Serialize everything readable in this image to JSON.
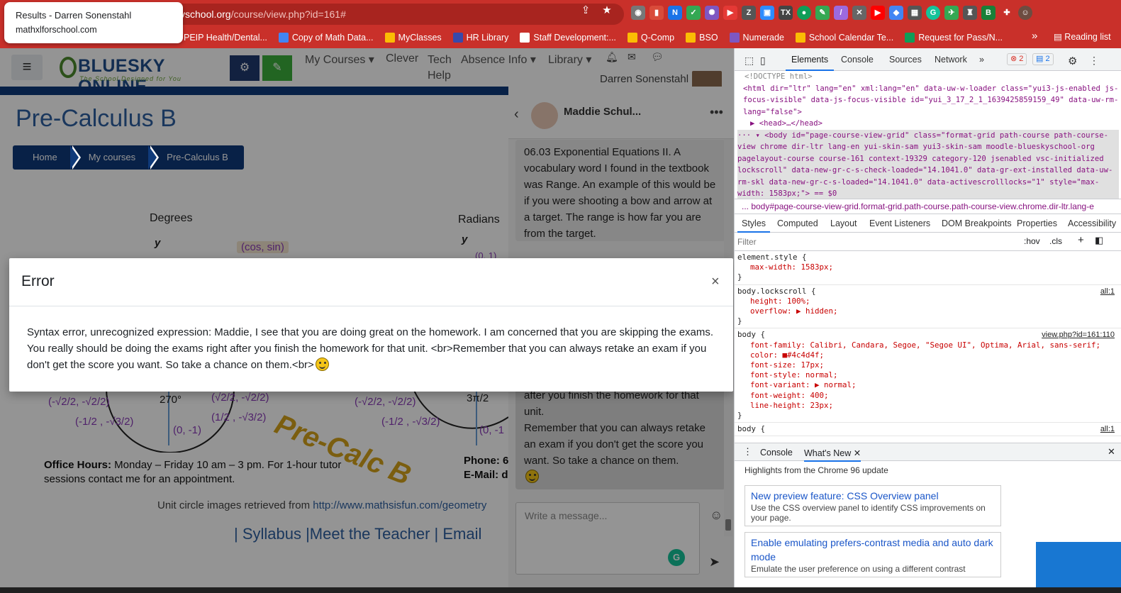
{
  "browser": {
    "tooltip_title": "Results - Darren Sonenstahl",
    "tooltip_url": "mathxlforschool.com",
    "url_main": "yschool.org",
    "url_path": "/course/view.php?id=161#",
    "bookmarks": [
      {
        "label": "PEIP Health/Dental...",
        "color": "#e8710a"
      },
      {
        "label": "Copy of Math Data...",
        "color": "#4285f4"
      },
      {
        "label": "MyClasses",
        "color": "#fbbc04"
      },
      {
        "label": "HR Library",
        "color": "#3949ab"
      },
      {
        "label": "Staff Development:...",
        "color": "#ffffff"
      },
      {
        "label": "Q-Comp",
        "color": "#fbbc04"
      },
      {
        "label": "BSO",
        "color": "#fbbc04"
      },
      {
        "label": "Numerade",
        "color": "#7e57c2"
      },
      {
        "label": "School Calendar Te...",
        "color": "#fbbc04"
      },
      {
        "label": "Request for Pass/N...",
        "color": "#0f9d58"
      }
    ],
    "bookmarks_more": "»",
    "reading_list": "Reading list"
  },
  "site": {
    "logo_text": "BLUESKY ONLINE",
    "logo_tagline": "The School Designed for You",
    "nav": {
      "my_courses": "My Courses ▾",
      "clever": "Clever",
      "tech_help_1": "Tech",
      "tech_help_2": "Help",
      "absence": "Absence Info ▾",
      "library": "Library ▾"
    },
    "user_name": "Darren Sonenstahl",
    "page_title": "Pre-Calculus B",
    "breadcrumb": [
      "Home",
      "My courses",
      "Pre-Calculus B"
    ]
  },
  "content": {
    "degrees": "Degrees",
    "radians": "Radians",
    "y_axis": "y",
    "cos_sin": "(cos, sin)",
    "point_0_1_radians": "(0, 1)",
    "label_270": "270°",
    "label_3pi2": "3π/2",
    "pt_sqrt2_left": "(-√2/2, -√2/2)",
    "pt_sqrt2_right": "(√2/2, -√2/2)",
    "pt_half_left": "(-1/2 , -√3/2)",
    "pt_half_right": "(1/2 , -√3/2)",
    "pt_0_neg1": "(0, -1)",
    "pt_sqrt2_left_r": "(-√2/2, -√2/2)",
    "pt_half_left_r": "(-1/2 , -√3/2)",
    "pt_0_neg1_r": "(0, -1",
    "precalc_stamp": "Pre-Calc B",
    "office_hours_label": "Office Hours:",
    "office_hours_text": " Monday – Friday 10 am – 3 pm.  For 1-hour tutor sessions contact me for an appointment.",
    "phone_label": "Phone: 6",
    "email_label": "E-Mail: d",
    "credit_text": "Unit circle images retrieved from ",
    "credit_link": "http://www.mathsisfun.com/geometry",
    "links": "| Syllabus |Meet the Teacher | Email"
  },
  "chat": {
    "name": "Maddie Schul...",
    "msg1": "06.03 Exponential Equations II. A vocabulary word I found in the textbook was Range. An example of this would be if you were shooting a bow and arrow at a target. The range is how far you are from the target.",
    "msg2_partial": "after you finish the homework for that unit.",
    "msg2_rest": "Remember that you can always retake an exam if you don't get the score you want. So take a chance on them.",
    "input_placeholder": "Write a message..."
  },
  "modal": {
    "title": "Error",
    "close": "×",
    "body": "Syntax error, unrecognized expression: Maddie, I see that you are doing great on the homework. I am concerned that you are skipping the exams. You really should be doing the exams right after you finish the homework for that unit. <br>Remember that you can always retake an exam if you don't get the score you want. So take a chance on them.<br>"
  },
  "devtools": {
    "tabs": [
      "Elements",
      "Console",
      "Sources",
      "Network",
      "»"
    ],
    "errors": "2",
    "messages": "2",
    "doctype": "<!DOCTYPE html>",
    "html_line": "<html dir=\"ltr\" lang=\"en\" xml:lang=\"en\" data-uw-w-loader class=\"yui3-js-enabled js-focus-visible\" data-js-focus-visible id=\"yui_3_17_2_1_1639425859159_49\" data-uw-rm-lang=\"false\">",
    "head_line": "▶ <head>…</head>",
    "body_line": "<body id=\"page-course-view-grid\" class=\"format-grid path-course path-course-view chrome dir-ltr lang-en yui-skin-sam yui3-skin-sam moodle-blueskyschool-org pagelayout-course course-161 context-19329 category-120 jsenabled vsc-initialized lockscroll\" data-new-gr-c-s-check-loaded=\"14.1041.0\" data-gr-ext-installed data-uw-rm-skl data-new-gr-c-s-loaded=\"14.1041.0\" data-activescrolllocks=\"1\" style=\"max-width: 1583px;\"> == $0",
    "crumb": "...   body#page-course-view-grid.format-grid.path-course.path-course-view.chrome.dir-ltr.lang-e",
    "subtabs": [
      "Styles",
      "Computed",
      "Layout",
      "Event Listeners",
      "DOM Breakpoints",
      "Properties",
      "Accessibility"
    ],
    "filter_placeholder": "Filter",
    "hov": ":hov",
    "cls": ".cls",
    "rules": [
      {
        "selector": "element.style {",
        "props": [
          "max-width: 1583px;"
        ],
        "src": ""
      },
      {
        "selector": "body.lockscroll {",
        "props": [
          "height: 100%;",
          "overflow: ▶ hidden;"
        ],
        "src": "all:1"
      },
      {
        "selector": "body {",
        "props": [
          "font-family: Calibri, Candara, Segoe, \"Segoe UI\", Optima, Arial, sans-serif;",
          "color: ■#4c4d4f;",
          "font-size: 17px;",
          "font-style: normal;",
          "font-variant: ▶ normal;",
          "font-weight: 400;",
          "line-height: 23px;"
        ],
        "src": "view.php?id=161:110"
      },
      {
        "selector": "body {",
        "props": [],
        "src": "all:1"
      }
    ],
    "drawer_tabs": [
      "Console",
      "What's New"
    ],
    "whats_new_head": "Highlights from the Chrome 96 update",
    "card1_title": "New preview feature: CSS Overview panel",
    "card1_text": "Use the CSS overview panel to identify CSS improvements on your page.",
    "card2_title": "Enable emulating prefers-contrast media and auto dark mode",
    "card2_text": "Emulate the user preference on using a different contrast"
  }
}
